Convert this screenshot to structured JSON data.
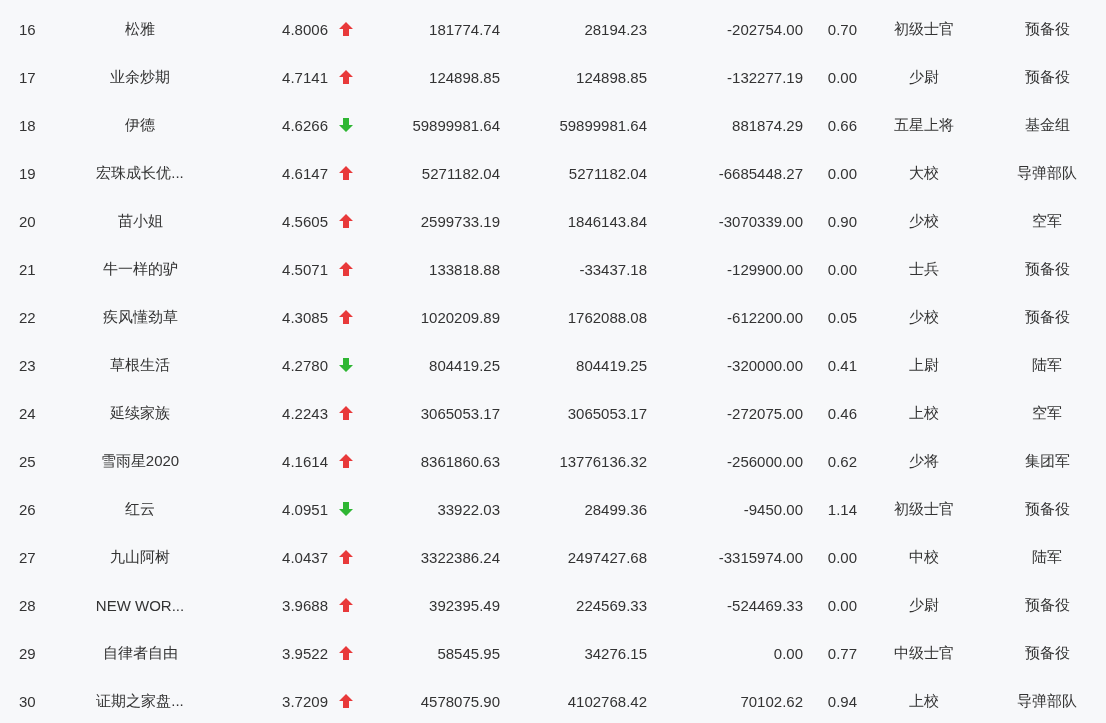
{
  "rows": [
    {
      "rank": "16",
      "name": "松雅",
      "score": "4.8006",
      "kind": "up",
      "column_4": "181774.74",
      "column_5": "28194.23",
      "column_6": "-202754.00",
      "column_7": "0.70",
      "rank_title": "初级士官",
      "group": "预备役"
    },
    {
      "rank": "17",
      "name": "业余炒期",
      "score": "4.7141",
      "kind": "up",
      "column_4": "124898.85",
      "column_5": "124898.85",
      "column_6": "-132277.19",
      "column_7": "0.00",
      "rank_title": "少尉",
      "group": "预备役"
    },
    {
      "rank": "18",
      "name": "伊德",
      "score": "4.6266",
      "kind": "down",
      "column_4": "59899981.64",
      "column_5": "59899981.64",
      "column_6": "881874.29",
      "column_7": "0.66",
      "rank_title": "五星上将",
      "group": "基金组"
    },
    {
      "rank": "19",
      "name": "宏珠成长优...",
      "score": "4.6147",
      "kind": "up",
      "column_4": "5271182.04",
      "column_5": "5271182.04",
      "column_6": "-6685448.27",
      "column_7": "0.00",
      "rank_title": "大校",
      "group": "导弹部队"
    },
    {
      "rank": "20",
      "name": "苗小姐",
      "score": "4.5605",
      "kind": "up",
      "column_4": "2599733.19",
      "column_5": "1846143.84",
      "column_6": "-3070339.00",
      "column_7": "0.90",
      "rank_title": "少校",
      "group": "空军"
    },
    {
      "rank": "21",
      "name": "牛一样的驴",
      "score": "4.5071",
      "kind": "up",
      "column_4": "133818.88",
      "column_5": "-33437.18",
      "column_6": "-129900.00",
      "column_7": "0.00",
      "rank_title": "士兵",
      "group": "预备役"
    },
    {
      "rank": "22",
      "name": "疾风懂劲草",
      "score": "4.3085",
      "kind": "up",
      "column_4": "1020209.89",
      "column_5": "1762088.08",
      "column_6": "-612200.00",
      "column_7": "0.05",
      "rank_title": "少校",
      "group": "预备役"
    },
    {
      "rank": "23",
      "name": "草根生活",
      "score": "4.2780",
      "kind": "down",
      "column_4": "804419.25",
      "column_5": "804419.25",
      "column_6": "-320000.00",
      "column_7": "0.41",
      "rank_title": "上尉",
      "group": "陆军"
    },
    {
      "rank": "24",
      "name": "延续家族",
      "score": "4.2243",
      "kind": "up",
      "column_4": "3065053.17",
      "column_5": "3065053.17",
      "column_6": "-272075.00",
      "column_7": "0.46",
      "rank_title": "上校",
      "group": "空军"
    },
    {
      "rank": "25",
      "name": "雪雨星2020",
      "score": "4.1614",
      "kind": "up",
      "column_4": "8361860.63",
      "column_5": "13776136.32",
      "column_6": "-256000.00",
      "column_7": "0.62",
      "rank_title": "少将",
      "group": "集团军"
    },
    {
      "rank": "26",
      "name": "红云",
      "score": "4.0951",
      "kind": "down",
      "column_4": "33922.03",
      "column_5": "28499.36",
      "column_6": "-9450.00",
      "column_7": "1.14",
      "rank_title": "初级士官",
      "group": "预备役"
    },
    {
      "rank": "27",
      "name": "九山阿树",
      "score": "4.0437",
      "kind": "up",
      "column_4": "3322386.24",
      "column_5": "2497427.68",
      "column_6": "-3315974.00",
      "column_7": "0.00",
      "rank_title": "中校",
      "group": "陆军"
    },
    {
      "rank": "28",
      "name": "NEW WOR...",
      "score": "3.9688",
      "kind": "up",
      "column_4": "392395.49",
      "column_5": "224569.33",
      "column_6": "-524469.33",
      "column_7": "0.00",
      "rank_title": "少尉",
      "group": "预备役"
    },
    {
      "rank": "29",
      "name": "自律者自由",
      "score": "3.9522",
      "kind": "up",
      "column_4": "58545.95",
      "column_5": "34276.15",
      "column_6": "0.00",
      "column_7": "0.77",
      "rank_title": "中级士官",
      "group": "预备役"
    },
    {
      "rank": "30",
      "name": "证期之家盘...",
      "score": "3.7209",
      "kind": "up",
      "column_4": "4578075.90",
      "column_5": "4102768.42",
      "column_6": "70102.62",
      "column_7": "0.94",
      "rank_title": "上校",
      "group": "导弹部队"
    }
  ]
}
